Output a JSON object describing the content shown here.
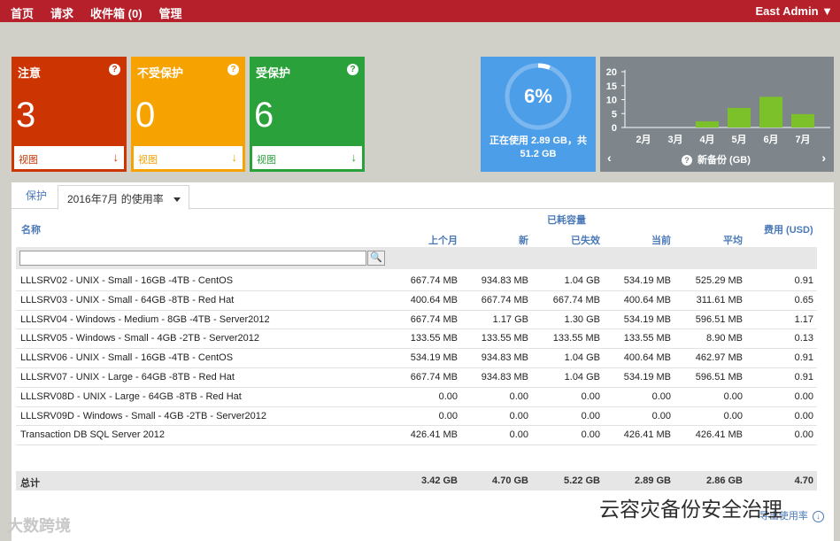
{
  "topbar": {
    "nav": [
      "首页",
      "请求",
      "收件箱 (0)",
      "管理"
    ],
    "user": "East Admin ▼"
  },
  "cards": [
    {
      "title": "注意",
      "value": "3",
      "link": "视图",
      "color": "#cc3402"
    },
    {
      "title": "不受保护",
      "value": "0",
      "link": "视图",
      "color": "#f6a200"
    },
    {
      "title": "受保护",
      "value": "6",
      "link": "视图",
      "color": "#2aa13a"
    }
  ],
  "help_icon": "?",
  "usage": {
    "percent_label": "6%",
    "percent_value": 6,
    "caption_line1": "正在使用 2.89 GB，共",
    "caption_line2": "51.2 GB",
    "color": "#4d9ee8"
  },
  "backup": {
    "label": "新备份 (GB)",
    "prev": "‹",
    "next": "›"
  },
  "chart_data": {
    "type": "bar",
    "categories": [
      "2月",
      "3月",
      "4月",
      "5月",
      "6月",
      "7月"
    ],
    "values": [
      0,
      0,
      2.2,
      7,
      11,
      4.8
    ],
    "ylabel": "新备份 (GB)",
    "yticks": [
      0,
      5,
      10,
      15,
      20
    ],
    "ylim": [
      0,
      20
    ],
    "bar_color": "#7dc12a",
    "grid": false
  },
  "tabs": {
    "protect": "保护",
    "usage": "2016年7月 的使用率"
  },
  "table": {
    "col_name": "名称",
    "group_header": "已耗容量",
    "col_last_month": "上个月",
    "col_new": "新",
    "col_lost": "已失效",
    "col_current": "当前",
    "col_avg": "平均",
    "col_cost": "费用 (USD)",
    "search_value": "",
    "search_icon": "🔍",
    "rows": [
      {
        "name": "LLLSRV02 - UNIX - Small - 16GB -4TB - CentOS",
        "last": "667.74 MB",
        "new": "934.83 MB",
        "lost": "1.04 GB",
        "cur": "534.19 MB",
        "avg": "525.29 MB",
        "cost": "0.91"
      },
      {
        "name": "LLLSRV03 - UNIX - Small - 64GB -8TB - Red Hat",
        "last": "400.64 MB",
        "new": "667.74 MB",
        "lost": "667.74 MB",
        "cur": "400.64 MB",
        "avg": "311.61 MB",
        "cost": "0.65"
      },
      {
        "name": "LLLSRV04 - Windows - Medium - 8GB -4TB - Server2012",
        "last": "667.74 MB",
        "new": "1.17 GB",
        "lost": "1.30 GB",
        "cur": "534.19 MB",
        "avg": "596.51 MB",
        "cost": "1.17"
      },
      {
        "name": "LLLSRV05 - Windows - Small - 4GB -2TB - Server2012",
        "last": "133.55 MB",
        "new": "133.55 MB",
        "lost": "133.55 MB",
        "cur": "133.55 MB",
        "avg": "8.90 MB",
        "cost": "0.13"
      },
      {
        "name": "LLLSRV06 - UNIX - Small - 16GB -4TB - CentOS",
        "last": "534.19 MB",
        "new": "934.83 MB",
        "lost": "1.04 GB",
        "cur": "400.64 MB",
        "avg": "462.97 MB",
        "cost": "0.91"
      },
      {
        "name": "LLLSRV07 - UNIX - Large - 64GB -8TB - Red Hat",
        "last": "667.74 MB",
        "new": "934.83 MB",
        "lost": "1.04 GB",
        "cur": "534.19 MB",
        "avg": "596.51 MB",
        "cost": "0.91"
      },
      {
        "name": "LLLSRV08D - UNIX - Large - 64GB -8TB - Red Hat",
        "last": "0.00",
        "new": "0.00",
        "lost": "0.00",
        "cur": "0.00",
        "avg": "0.00",
        "cost": "0.00"
      },
      {
        "name": "LLLSRV09D - Windows - Small - 4GB -2TB - Server2012",
        "last": "0.00",
        "new": "0.00",
        "lost": "0.00",
        "cur": "0.00",
        "avg": "0.00",
        "cost": "0.00"
      },
      {
        "name": "Transaction DB SQL Server 2012",
        "last": "426.41 MB",
        "new": "0.00",
        "lost": "0.00",
        "cur": "426.41 MB",
        "avg": "426.41 MB",
        "cost": "0.00"
      }
    ],
    "total": {
      "label": "总计",
      "last": "3.42 GB",
      "new": "4.70 GB",
      "lost": "5.22 GB",
      "cur": "2.89 GB",
      "avg": "2.86 GB",
      "cost": "4.70"
    }
  },
  "export_label": "导出使用率",
  "watermark_left": "大数跨境",
  "watermark_right": "云容灾备份安全治理"
}
